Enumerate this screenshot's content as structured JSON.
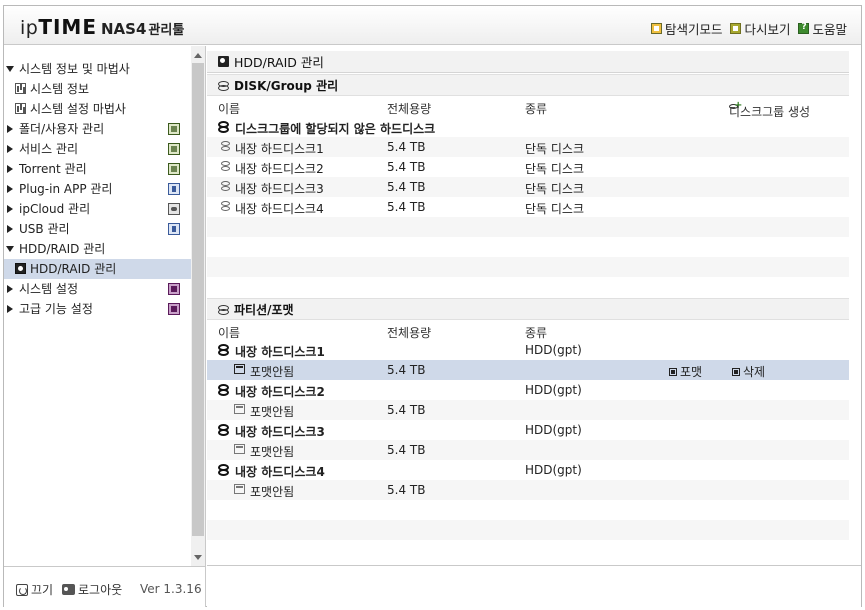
{
  "header": {
    "logo_ip": "ip",
    "logo_time": "TIME",
    "logo_nas": "NAS4",
    "logo_kr": "관리툴",
    "links": [
      "탐색기모드",
      "다시보기",
      "도움말"
    ]
  },
  "sidebar": {
    "items": [
      {
        "label": "시스템 정보 및 마법사",
        "expanded": true,
        "icon": ""
      },
      {
        "label": "시스템 정보",
        "child": true,
        "icon": "chart-icon"
      },
      {
        "label": "시스템 설정 마법사",
        "child": true,
        "icon": "chart-icon"
      },
      {
        "label": "폴더/사용자 관리",
        "expanded": false,
        "icon": "folder-user-icon"
      },
      {
        "label": "서비스 관리",
        "expanded": false,
        "icon": "service-icon"
      },
      {
        "label": "Torrent 관리",
        "expanded": false,
        "icon": "torrent-icon"
      },
      {
        "label": "Plug-in APP 관리",
        "expanded": false,
        "icon": "plugin-icon"
      },
      {
        "label": "ipCloud 관리",
        "expanded": false,
        "icon": "cloud-icon"
      },
      {
        "label": "USB 관리",
        "expanded": false,
        "icon": "usb-icon"
      },
      {
        "label": "HDD/RAID 관리",
        "expanded": true,
        "icon": ""
      },
      {
        "label": "HDD/RAID 관리",
        "child": true,
        "selected": true,
        "icon": "disk-icon"
      },
      {
        "label": "시스템 설정",
        "expanded": false,
        "icon": "settings-icon"
      },
      {
        "label": "고급 기능 설정",
        "expanded": false,
        "icon": "advanced-icon"
      }
    ],
    "footer": {
      "power": "끄기",
      "logout": "로그아웃",
      "version": "Ver 1.3.16"
    }
  },
  "main": {
    "title": "HDD/RAID 관리",
    "disk_section": {
      "title": "DISK/Group 관리",
      "columns": [
        "이름",
        "전체용량",
        "종류"
      ],
      "create_group": "디스크그룹 생성",
      "unassigned_label": "디스크그룹에 할당되지 않은 하드디스크",
      "disks": [
        {
          "name": "내장 하드디스크1",
          "size": "5.4 TB",
          "type": "단독 디스크"
        },
        {
          "name": "내장 하드디스크2",
          "size": "5.4 TB",
          "type": "단독 디스크"
        },
        {
          "name": "내장 하드디스크3",
          "size": "5.4 TB",
          "type": "단독 디스크"
        },
        {
          "name": "내장 하드디스크4",
          "size": "5.4 TB",
          "type": "단독 디스크"
        }
      ]
    },
    "partition_section": {
      "title": "파티션/포맷",
      "columns": [
        "이름",
        "전체용량",
        "종류"
      ],
      "disks": [
        {
          "name": "내장 하드디스크1",
          "type": "HDD(gpt)",
          "part": "포맷안됨",
          "size": "5.4 TB"
        },
        {
          "name": "내장 하드디스크2",
          "type": "HDD(gpt)",
          "part": "포맷안됨",
          "size": "5.4 TB"
        },
        {
          "name": "내장 하드디스크3",
          "type": "HDD(gpt)",
          "part": "포맷안됨",
          "size": "5.4 TB"
        },
        {
          "name": "내장 하드디스크4",
          "type": "HDD(gpt)",
          "part": "포맷안됨",
          "size": "5.4 TB"
        }
      ],
      "actions": {
        "format": "포맷",
        "delete": "삭제"
      }
    }
  }
}
